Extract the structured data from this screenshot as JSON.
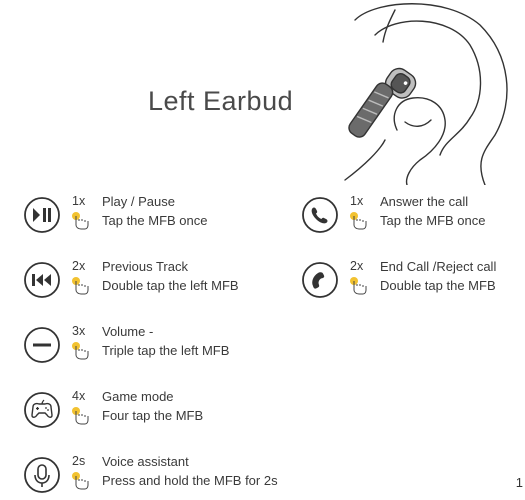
{
  "title": "Left Earbud",
  "illustration_icon": "ear-with-earbud-and-finger-icon",
  "page_number": "1",
  "items": [
    {
      "icon": "play-pause-icon",
      "count": "1x",
      "label": "Play / Pause",
      "sub": "Tap the MFB once"
    },
    {
      "icon": "previous-track-icon",
      "count": "2x",
      "label": "Previous Track",
      "sub": "Double tap the left MFB"
    },
    {
      "icon": "volume-down-icon",
      "count": "3x",
      "label": "Volume -",
      "sub": "Triple tap the left MFB"
    },
    {
      "icon": "game-controller-icon",
      "count": "4x",
      "label": "Game mode",
      "sub": "Four tap the MFB"
    },
    {
      "icon": "microphone-icon",
      "count": "2s",
      "label": "Voice assistant",
      "sub": "Press and hold the MFB for 2s"
    },
    {
      "icon": "answer-call-icon",
      "count": "1x",
      "label": "Answer the call",
      "sub": "Tap the MFB once"
    },
    {
      "icon": "end-call-icon",
      "count": "2x",
      "label": "End Call /Reject call",
      "sub": "Double tap the MFB"
    }
  ]
}
